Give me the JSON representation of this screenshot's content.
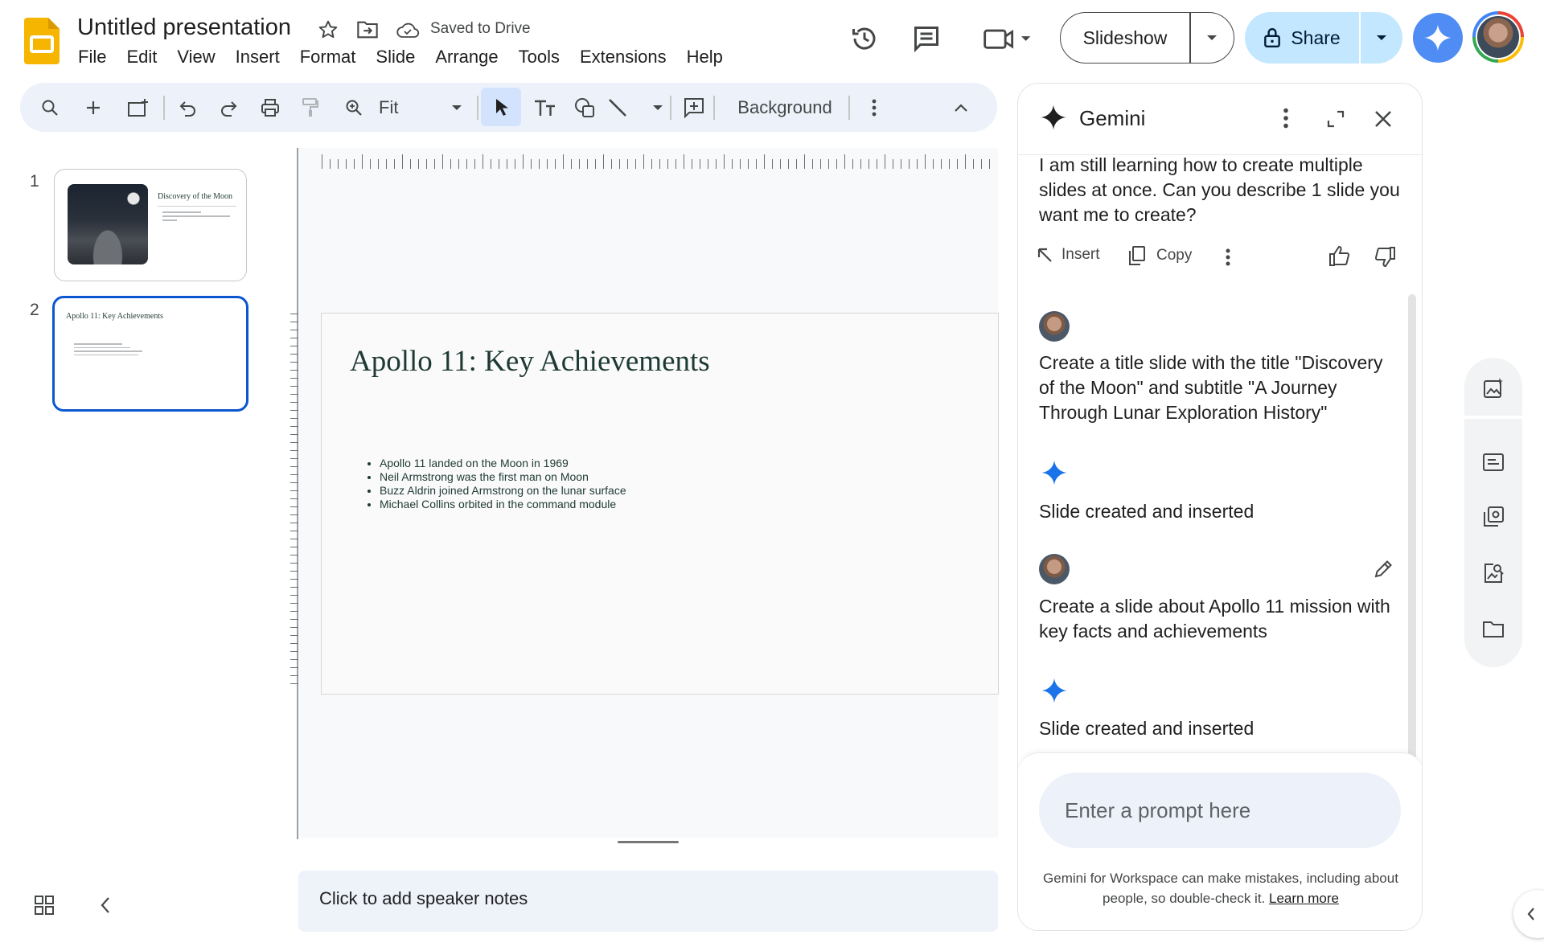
{
  "header": {
    "doc_title": "Untitled presentation",
    "save_status": "Saved to Drive",
    "menu": [
      "File",
      "Edit",
      "View",
      "Insert",
      "Format",
      "Slide",
      "Arrange",
      "Tools",
      "Extensions",
      "Help"
    ],
    "slideshow_label": "Slideshow",
    "share_label": "Share"
  },
  "toolbar": {
    "zoom_label": "Fit",
    "background_label": "Background"
  },
  "filmstrip": {
    "slides": [
      {
        "number": "1",
        "title": "Discovery of the Moon"
      },
      {
        "number": "2",
        "title": "Apollo 11: Key Achievements"
      }
    ]
  },
  "slide": {
    "title": "Apollo 11: Key Achievements",
    "bullets": [
      "Apollo 11 landed on the Moon in 1969",
      "Neil Armstrong was the first man on Moon",
      "Buzz Aldrin joined Armstrong on the lunar surface",
      "Michael Collins orbited in the command module"
    ]
  },
  "notes": {
    "placeholder": "Click to add speaker notes"
  },
  "gemini": {
    "title": "Gemini",
    "intro_message": "I am still learning how to create multiple slides at once. Can you describe 1 slide you want me to create?",
    "insert_label": "Insert",
    "copy_label": "Copy",
    "user_prompt_1": "Create a title slide with the title \"Discovery of the Moon\" and subtitle \"A Journey Through Lunar Exploration History\"",
    "reply_1": "Slide created and inserted",
    "user_prompt_2": "Create a slide about Apollo 11 mission with key facts and achievements",
    "reply_2": "Slide created and inserted",
    "prompt_placeholder": "Enter a prompt here",
    "disclaimer": "Gemini for Workspace can make mistakes, including about people, so double-check it.",
    "learn_more": "Learn more"
  },
  "colors": {
    "accent": "#0b57d0",
    "share_bg": "#c2e7ff",
    "gemini_star": "#1a73e8",
    "toolbar_bg": "#edf2fa"
  }
}
